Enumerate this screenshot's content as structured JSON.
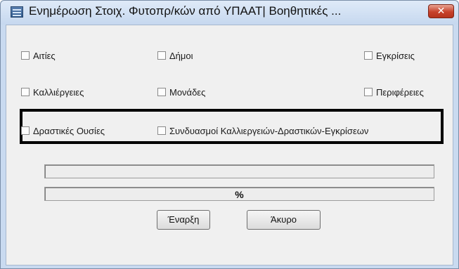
{
  "window": {
    "title": "Ενημέρωση Στοιχ. Φυτοπρ/κών από ΥΠΑΑΤ| Βοηθητικές ...",
    "close_glyph": "✕",
    "app_icon": "form-app-icon"
  },
  "checkboxes": {
    "aities": {
      "label": "Αιτίες",
      "checked": false
    },
    "dimoi": {
      "label": "Δήμοι",
      "checked": false
    },
    "egkriseis": {
      "label": "Εγκρίσεις",
      "checked": false
    },
    "kalliergeies": {
      "label": "Καλλιέργειες",
      "checked": false
    },
    "monades": {
      "label": "Μονάδες",
      "checked": false
    },
    "perifereies": {
      "label": "Περιφέρειες",
      "checked": false
    },
    "drastikes_ousies": {
      "label": "Δραστικές Ουσίες",
      "checked": false
    },
    "syndyasmoi": {
      "label": "Συνδυασμοί Καλλιεργειών-Δραστικών-Εγκρίσεων",
      "checked": false
    }
  },
  "progress": {
    "overall_fraction": 0,
    "item_fraction": 0,
    "percent_label": "%"
  },
  "buttons": {
    "start": "Έναρξη",
    "cancel": "Άκυρο"
  },
  "colors": {
    "title_bar": "#c6d8ef",
    "close_button": "#c7412b",
    "client_bg": "#f0f0f0",
    "highlight_border": "#000000",
    "progress_fill": "#3a82d4"
  }
}
